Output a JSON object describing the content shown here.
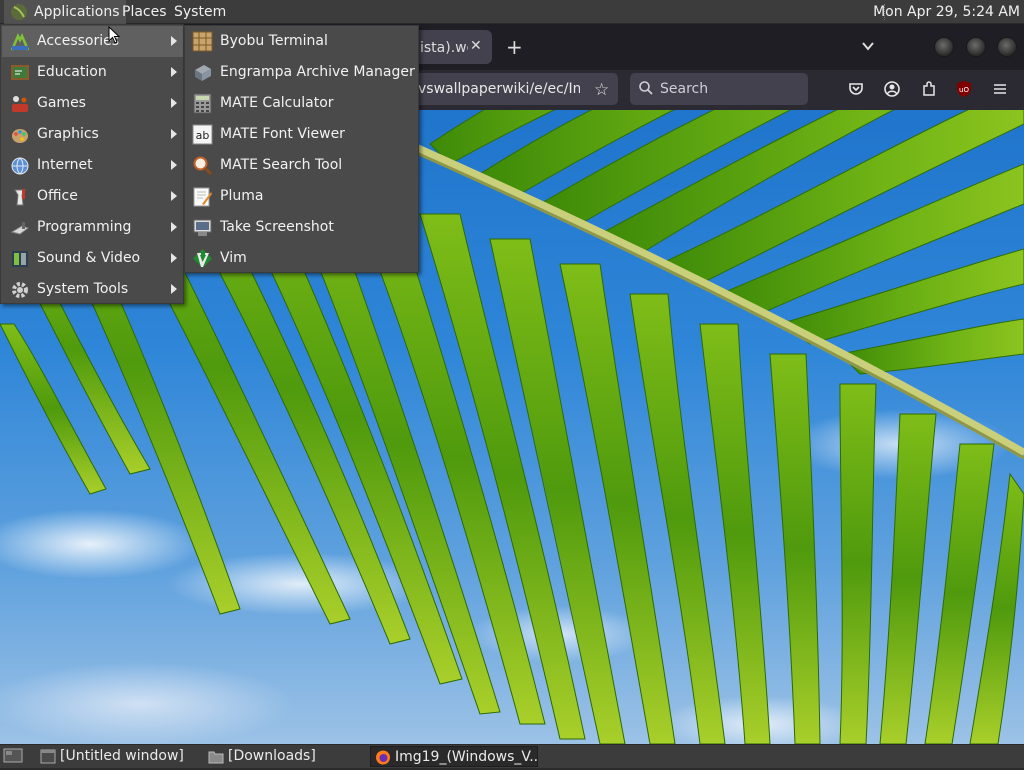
{
  "top_panel": {
    "menus": [
      "Applications",
      "Places",
      "System"
    ],
    "clock": "Mon Apr 29,  5:24 AM"
  },
  "applications_menu": {
    "items": [
      {
        "label": "Accessories",
        "icon": "accessories-icon",
        "active": true
      },
      {
        "label": "Education",
        "icon": "education-icon"
      },
      {
        "label": "Games",
        "icon": "games-icon"
      },
      {
        "label": "Graphics",
        "icon": "graphics-icon"
      },
      {
        "label": "Internet",
        "icon": "internet-icon"
      },
      {
        "label": "Office",
        "icon": "office-icon"
      },
      {
        "label": "Programming",
        "icon": "programming-icon"
      },
      {
        "label": "Sound & Video",
        "icon": "sound-video-icon"
      },
      {
        "label": "System Tools",
        "icon": "system-tools-icon"
      }
    ]
  },
  "accessories_submenu": {
    "items": [
      {
        "label": "Byobu Terminal",
        "icon": "byobu-terminal-icon"
      },
      {
        "label": "Engrampa Archive Manager",
        "icon": "archive-manager-icon"
      },
      {
        "label": "MATE Calculator",
        "icon": "calculator-icon"
      },
      {
        "label": "MATE Font Viewer",
        "icon": "font-viewer-icon"
      },
      {
        "label": "MATE Search Tool",
        "icon": "search-tool-icon"
      },
      {
        "label": "Pluma",
        "icon": "pluma-icon"
      },
      {
        "label": "Take Screenshot",
        "icon": "screenshot-icon"
      },
      {
        "label": "Vim",
        "icon": "vim-icon"
      }
    ]
  },
  "browser": {
    "tab_title": "ista).we",
    "url_fragment": "vswallpaperwiki/e/ec/Img",
    "search_placeholder": "Search"
  },
  "taskbar": {
    "tasks": [
      {
        "label": "[Untitled window]",
        "icon": "window-icon"
      },
      {
        "label": "[Downloads]",
        "icon": "folder-icon"
      },
      {
        "label": "Img19_(Windows_V...",
        "icon": "firefox-icon",
        "active": true
      }
    ]
  },
  "colors": {
    "panel": "#3c3c3c",
    "menu_bg": "#4a4a4a",
    "menu_active": "#606060",
    "firefox_toolbar": "#2b2a33"
  }
}
